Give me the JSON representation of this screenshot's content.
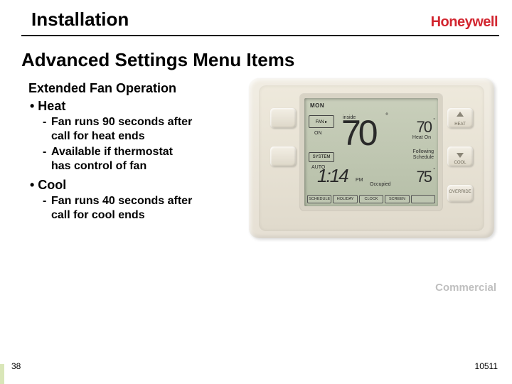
{
  "header": {
    "title": "Installation",
    "brand": "Honeywell"
  },
  "section_title": "Advanced Settings Menu Items",
  "subheading": "Extended Fan Operation",
  "bullets": {
    "heat": {
      "label": "• Heat",
      "sub1a": "Fan runs 90 seconds after",
      "sub1b": "call for heat ends",
      "sub2a": "Available if thermostat",
      "sub2b": "has control of fan"
    },
    "cool": {
      "label": "• Cool",
      "sub1a": "Fan runs 40 seconds after",
      "sub1b": "call for cool ends"
    }
  },
  "thermostat": {
    "day": "MON",
    "inside_label": "inside",
    "inside_temp": "70",
    "heat_setpoint": "70",
    "heat_sublabel": "Heat On",
    "following": "Following Schedule",
    "time": "1:14",
    "ampm": "PM",
    "occupied": "Occupied",
    "cool_setpoint": "75",
    "fan_box": "FAN ▸",
    "fan_mode": "ON",
    "system_box": "SYSTEM",
    "system_mode": "AUTO",
    "heat_btn": "HEAT",
    "cool_btn": "COOL",
    "override_btn": "OVERRIDE",
    "bottom_buttons": [
      "SCHEDULE",
      "HOLIDAY",
      "CLOCK",
      "SCREEN",
      ""
    ]
  },
  "commercial_label": "Commercial",
  "page_number": "38",
  "doc_id": "10511"
}
